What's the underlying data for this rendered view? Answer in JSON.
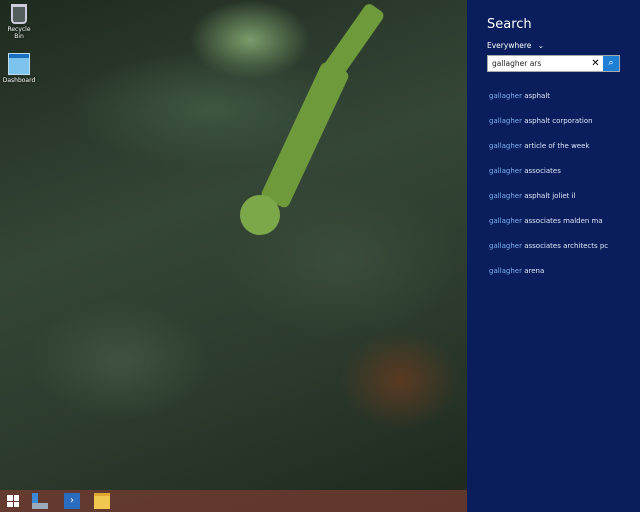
{
  "desktop": {
    "icons": [
      {
        "label": "Recycle Bin",
        "icon": "recycle-bin-icon"
      },
      {
        "label": "Dashboard",
        "icon": "dashboard-icon"
      }
    ]
  },
  "taskbar": {
    "items": [
      "start-icon",
      "server-manager-icon",
      "powershell-icon",
      "file-explorer-icon"
    ]
  },
  "search": {
    "title": "Search",
    "scope": "Everywhere",
    "query": "gallagher ars",
    "clear": "✕",
    "go": "⌕",
    "suggestions": [
      {
        "match": "gallagher",
        "rest": " asphalt"
      },
      {
        "match": "gallagher",
        "rest": " asphalt corporation"
      },
      {
        "match": "gallagher",
        "rest": " article of the week"
      },
      {
        "match": "gallagher",
        "rest": " associates"
      },
      {
        "match": "gallagher",
        "rest": " asphalt joliet il"
      },
      {
        "match": "gallagher",
        "rest": " associates malden ma"
      },
      {
        "match": "gallagher",
        "rest": " associates architects pc"
      },
      {
        "match": "gallagher",
        "rest": " arena"
      }
    ]
  },
  "colors": {
    "charm": "#0a1e5e",
    "accent": "#1f7fd4",
    "match": "#7ab0ee"
  }
}
